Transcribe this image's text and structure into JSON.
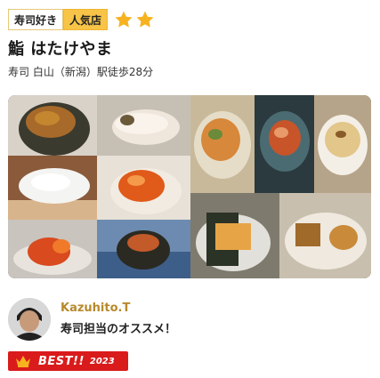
{
  "tags": {
    "primary": "寿司好き",
    "secondary": "人気店"
  },
  "rating": {
    "stars": 2,
    "star_color": "#f6b21f",
    "icon": "star-icon"
  },
  "restaurant": {
    "name": "鮨 はたけやま",
    "meta": "寿司  白山（新潟）駅徒歩28分"
  },
  "reviewer": {
    "name": "Kazuhito.T",
    "comment": "寿司担当のオススメ！",
    "name_color": "#b68a2c"
  },
  "badge": {
    "label": "BEST!!",
    "year": "2023",
    "color": "#d91b1b",
    "icon": "crown-icon"
  }
}
